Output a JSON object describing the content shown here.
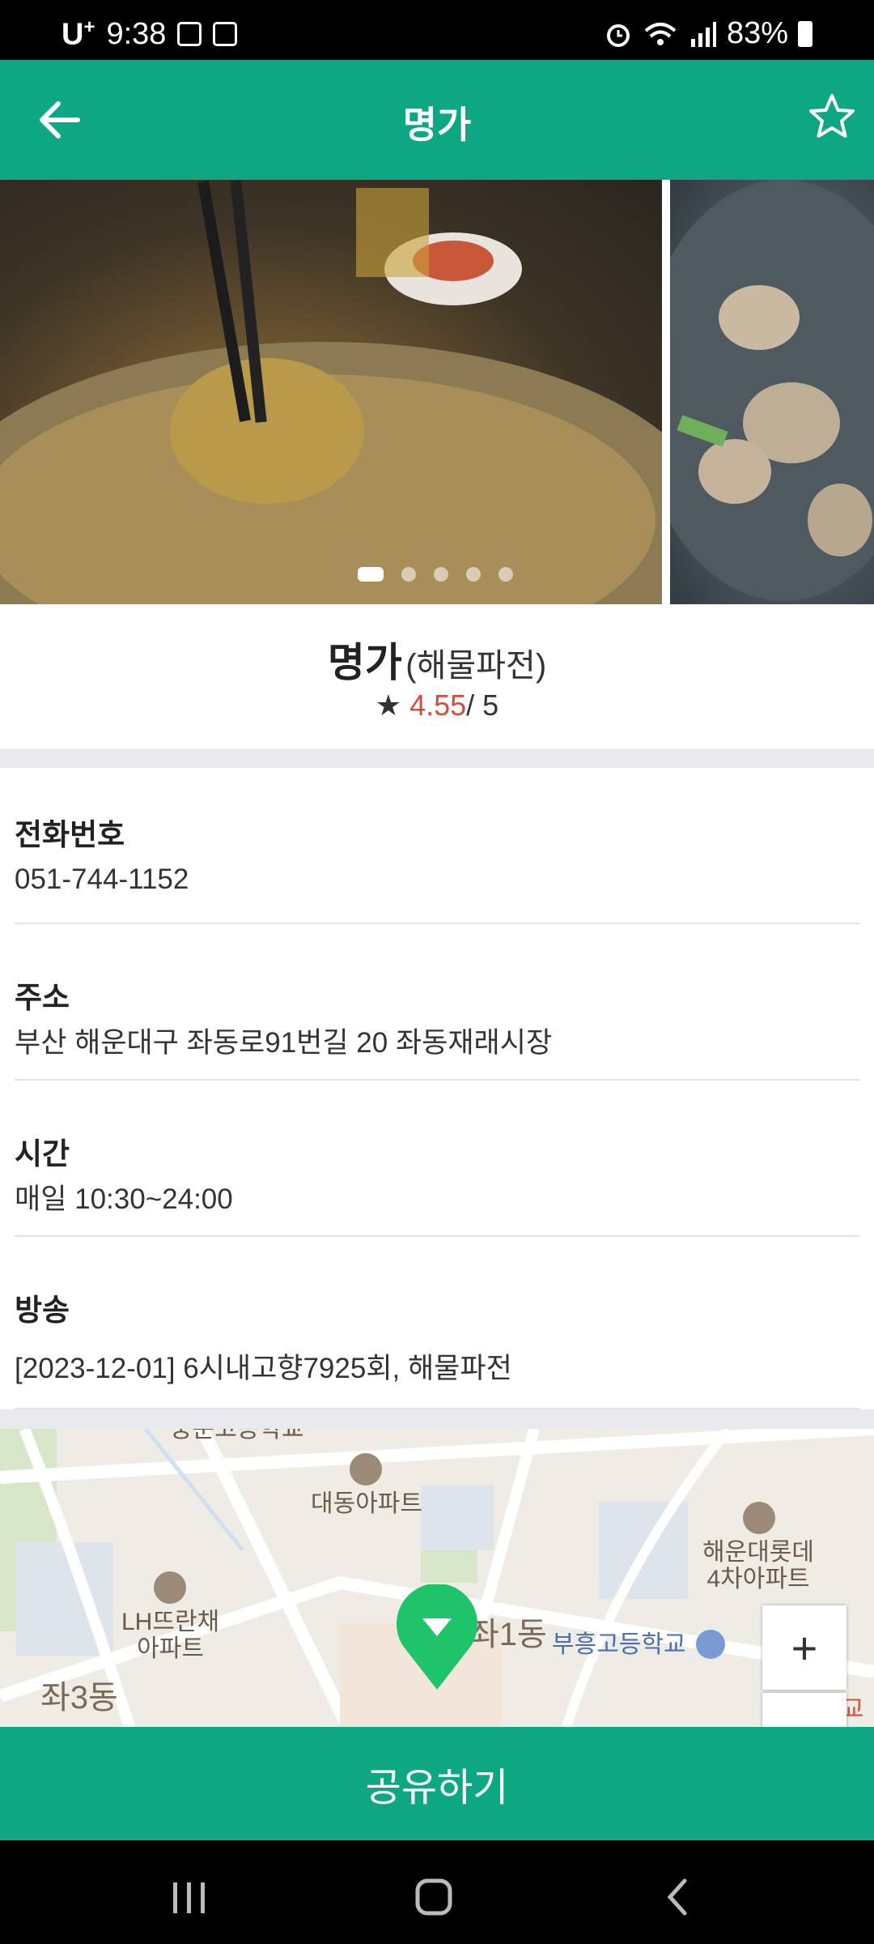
{
  "status_bar": {
    "carrier": "U",
    "carrier_sup": "+",
    "time": "9:38",
    "battery": "83%"
  },
  "app_bar": {
    "title": "명가"
  },
  "gallery": {
    "photo_count": 5,
    "active_index": 0
  },
  "restaurant": {
    "name": "명가",
    "menu": "(해물파전)",
    "rating_star": "★",
    "rating": "4.55",
    "rating_max": "/ 5"
  },
  "details": [
    {
      "label": "전화번호",
      "value": "051-744-1152"
    },
    {
      "label": "주소",
      "value": "부산 해운대구 좌동로91번길 20 좌동재래시장"
    },
    {
      "label": "시간",
      "value": "매일 10:30~24:00"
    },
    {
      "label": "방송",
      "value": "[2023-12-01] 6시내고향7925회, 해물파전"
    }
  ],
  "map": {
    "labels": {
      "top_cut": "중문고등학교",
      "daedong": "대동아파트",
      "haeundae_lotte": "해운대롯데\n4차아파트",
      "lh": "LH뜨란채\n아파트",
      "jwa1": "좌1동",
      "buheung": "부흥고등학교",
      "jwa3": "좌3동",
      "corner": "교"
    },
    "zoom_in": "+"
  },
  "share_button": "공유하기",
  "colors": {
    "brand": "#0ea784",
    "rating": "#d94a3a"
  }
}
